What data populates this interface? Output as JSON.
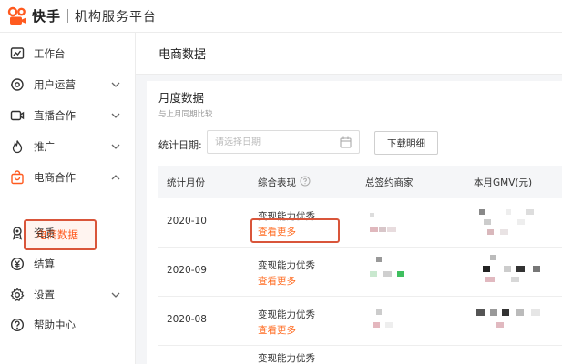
{
  "brand": {
    "name": "快手",
    "subtitle": "机构服务平台"
  },
  "sidebar": {
    "items": [
      {
        "label": "工作台",
        "icon": "dashboard-icon",
        "expandable": false
      },
      {
        "label": "用户运营",
        "icon": "user-ops-icon",
        "expandable": true,
        "expanded": false
      },
      {
        "label": "直播合作",
        "icon": "live-camera-icon",
        "expandable": true,
        "expanded": false
      },
      {
        "label": "推广",
        "icon": "flame-icon",
        "expandable": true,
        "expanded": false
      },
      {
        "label": "电商合作",
        "icon": "shopping-bag-icon",
        "expandable": true,
        "expanded": true
      },
      {
        "label": "资质",
        "icon": "certificate-icon",
        "expandable": false
      },
      {
        "label": "结算",
        "icon": "yuan-icon",
        "expandable": false
      },
      {
        "label": "设置",
        "icon": "gear-icon",
        "expandable": true,
        "expanded": false
      },
      {
        "label": "帮助中心",
        "icon": "help-icon",
        "expandable": false
      }
    ],
    "active_sub": "电商数据"
  },
  "main": {
    "title": "电商数据",
    "section_title": "月度数据",
    "section_subtitle": "与上月同期比较",
    "filter_label": "统计日期:",
    "date_placeholder": "请选择日期",
    "download_label": "下载明细",
    "columns": [
      "统计月份",
      "综合表现",
      "总签约商家",
      "本月GMV(元)"
    ],
    "rows": [
      {
        "month": "2020-10",
        "performance": "变现能力优秀",
        "link": "查看更多",
        "highlighted": true
      },
      {
        "month": "2020-09",
        "performance": "变现能力优秀",
        "link": "查看更多",
        "highlighted": false
      },
      {
        "month": "2020-08",
        "performance": "变现能力优秀",
        "link": "查看更多",
        "highlighted": false
      },
      {
        "month": "",
        "performance": "变现能力优秀",
        "link": "",
        "highlighted": false
      }
    ]
  },
  "colors": {
    "accent": "#ff5a1f",
    "highlight_border": "#d9553a"
  }
}
